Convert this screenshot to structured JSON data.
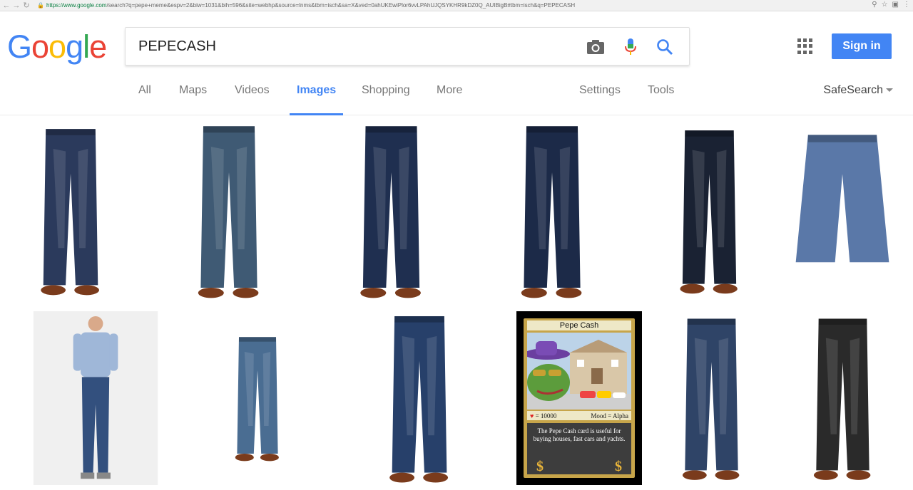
{
  "browser": {
    "url_secure": "https://",
    "url_host": "www.google.com",
    "url_path": "/search?q=pepe+meme&espv=2&biw=1031&bih=596&site=webhp&source=lnms&tbm=isch&sa=X&ved=0ahUKEwiPlor6vvLPAhUJQSYKHR9kDZ0Q_AUIBigB#tbm=isch&q=PEPECASH"
  },
  "logo": [
    "G",
    "o",
    "o",
    "g",
    "l",
    "e"
  ],
  "search": {
    "value": "PEPECASH"
  },
  "header": {
    "signin_label": "Sign in"
  },
  "tabs": [
    {
      "label": "All"
    },
    {
      "label": "Maps"
    },
    {
      "label": "Videos"
    },
    {
      "label": "Images"
    },
    {
      "label": "Shopping"
    },
    {
      "label": "More"
    },
    {
      "label": "Settings"
    },
    {
      "label": "Tools"
    }
  ],
  "safesearch_label": "SafeSearch",
  "colors": {
    "accent": "#4285f4",
    "google_blue": "#4285f4",
    "google_red": "#ea4335",
    "google_yellow": "#fbbc05",
    "google_green": "#34a853"
  },
  "results": [
    {
      "kind": "jeans",
      "color": "#2b3a5c"
    },
    {
      "kind": "jeans",
      "color": "#3f5a74"
    },
    {
      "kind": "jeans",
      "color": "#1f2f50"
    },
    {
      "kind": "jeans",
      "color": "#1c2a48"
    },
    {
      "kind": "jeans",
      "color": "#1a2233"
    },
    {
      "kind": "shorts",
      "color": "#5a78a8"
    },
    {
      "kind": "person",
      "color": "#33507e"
    },
    {
      "kind": "jeans",
      "color": "#4a6d92"
    },
    {
      "kind": "jeans",
      "color": "#27406a"
    },
    {
      "kind": "card",
      "color": "#000000"
    },
    {
      "kind": "jeans",
      "color": "#2f4467"
    },
    {
      "kind": "jeans",
      "color": "#2a2a2a"
    }
  ],
  "pepe_card": {
    "title": "Pepe Cash",
    "stat_left": "= 10000",
    "stat_right": "Mood = Alpha",
    "text": "The Pepe Cash card is useful for buying houses, fast cars and yachts.",
    "symbol": "$"
  }
}
